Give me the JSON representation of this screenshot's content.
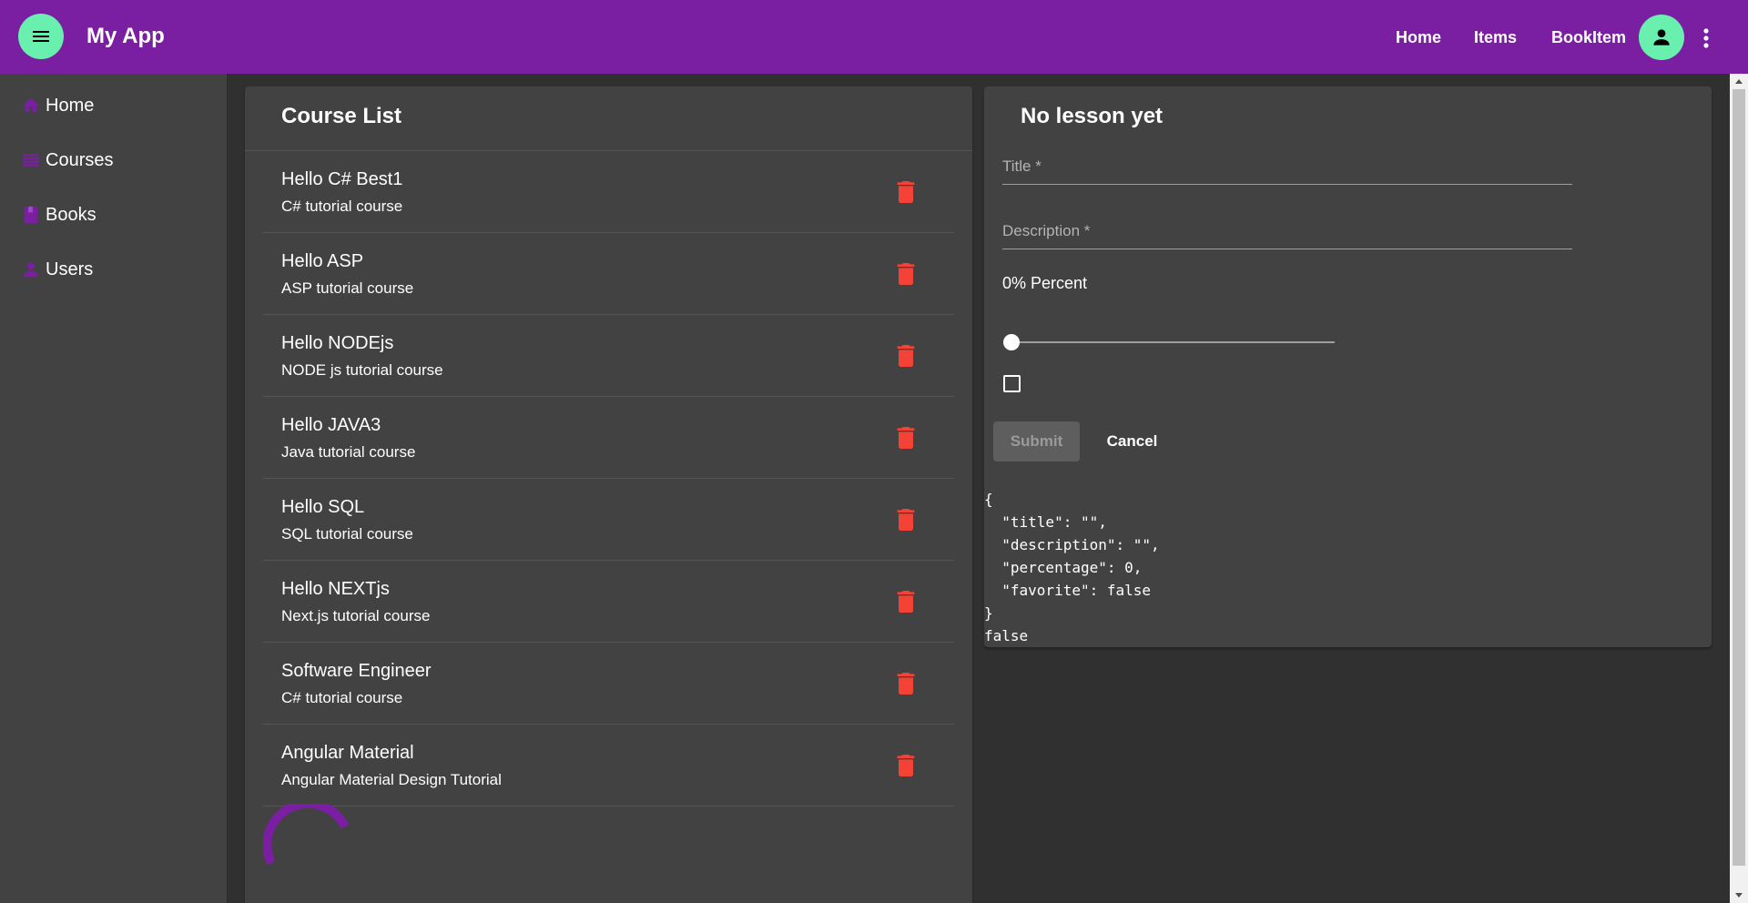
{
  "app": {
    "title": "My App",
    "brand_color": "#7b1fa2",
    "accent_color": "#69f0ae",
    "warn_color": "#f44336"
  },
  "toolbar": {
    "menu_icon": "menu-icon",
    "nav_links": [
      "Home",
      "Items",
      "BookItem"
    ],
    "account_icon": "account-icon",
    "more_icon": "more-vert-icon"
  },
  "sidenav": {
    "items": [
      {
        "label": "Home",
        "icon": "home-icon"
      },
      {
        "label": "Courses",
        "icon": "courses-icon"
      },
      {
        "label": "Books",
        "icon": "book-icon"
      },
      {
        "label": "Users",
        "icon": "person-icon"
      }
    ]
  },
  "course_list": {
    "title": "Course List",
    "courses": [
      {
        "title": "Hello C# Best1",
        "description": "C# tutorial course"
      },
      {
        "title": "Hello ASP",
        "description": "ASP tutorial course"
      },
      {
        "title": "Hello NODEjs",
        "description": "NODE js tutorial course"
      },
      {
        "title": "Hello JAVA3",
        "description": "Java tutorial course"
      },
      {
        "title": "Hello SQL",
        "description": "SQL tutorial course"
      },
      {
        "title": "Hello NEXTjs",
        "description": "Next.js tutorial course"
      },
      {
        "title": "Software Engineer",
        "description": "C# tutorial course"
      },
      {
        "title": "Angular Material",
        "description": "Angular Material Design Tutorial"
      }
    ]
  },
  "lesson_form": {
    "title": "No lesson yet",
    "title_placeholder": "Title *",
    "description_placeholder": "Description *",
    "percent_label": "0% Percent",
    "percentage": 0,
    "favorite_checked": false,
    "submit_label": "Submit",
    "cancel_label": "Cancel",
    "json_output": "{\n  \"title\": \"\",\n  \"description\": \"\",\n  \"percentage\": 0,\n  \"favorite\": false\n}\nfalse"
  }
}
